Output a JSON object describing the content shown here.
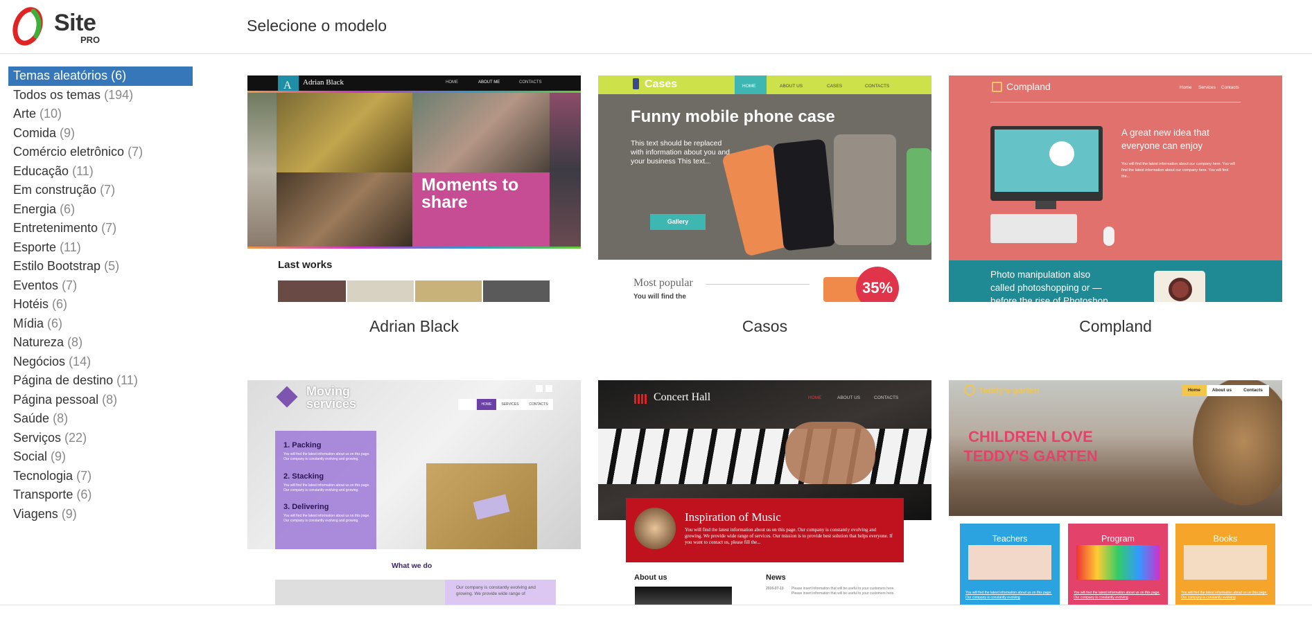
{
  "header": {
    "logo": {
      "word": "Site",
      "sub": "PRO"
    },
    "title": "Selecione o modelo"
  },
  "sidebar": {
    "categories": [
      {
        "label": "Temas aleatórios",
        "count": "(6)",
        "active": true
      },
      {
        "label": "Todos os temas",
        "count": "(194)"
      },
      {
        "label": "Arte",
        "count": "(10)"
      },
      {
        "label": "Comida",
        "count": "(9)"
      },
      {
        "label": "Comércio eletrônico",
        "count": "(7)"
      },
      {
        "label": "Educação",
        "count": "(11)"
      },
      {
        "label": "Em construção",
        "count": "(7)"
      },
      {
        "label": "Energia",
        "count": "(6)"
      },
      {
        "label": "Entretenimento",
        "count": "(7)"
      },
      {
        "label": "Esporte",
        "count": "(11)"
      },
      {
        "label": "Estilo Bootstrap",
        "count": "(5)"
      },
      {
        "label": "Eventos",
        "count": "(7)"
      },
      {
        "label": "Hotéis",
        "count": "(6)"
      },
      {
        "label": "Mídia",
        "count": "(6)"
      },
      {
        "label": "Natureza",
        "count": "(8)"
      },
      {
        "label": "Negócios",
        "count": "(14)"
      },
      {
        "label": "Página de destino",
        "count": "(11)"
      },
      {
        "label": "Página pessoal",
        "count": "(8)"
      },
      {
        "label": "Saúde",
        "count": "(8)"
      },
      {
        "label": "Serviços",
        "count": "(22)"
      },
      {
        "label": "Social",
        "count": "(9)"
      },
      {
        "label": "Tecnologia",
        "count": "(7)"
      },
      {
        "label": "Transporte",
        "count": "(6)"
      },
      {
        "label": "Viagens",
        "count": "(9)"
      }
    ]
  },
  "templates": [
    {
      "name": "Adrian Black",
      "preview": {
        "brand": "Adrian Black",
        "nav": [
          "HOME",
          "ABOUT ME",
          "CONTACTS"
        ],
        "headline": "Moments to share",
        "section": "Last works"
      }
    },
    {
      "name": "Casos",
      "preview": {
        "brand": "Cases",
        "nav": [
          "HOME",
          "ABOUT US",
          "CASES",
          "CONTACTS"
        ],
        "headline": "Funny mobile phone case",
        "body": "This text should be replaced with information about you and your business This text...",
        "button": "Gallery",
        "section": "Most popular",
        "section_sub": "You will find the",
        "badge": "35%"
      }
    },
    {
      "name": "Compland",
      "preview": {
        "brand": "Compland",
        "nav": [
          "Home",
          "Services",
          "Contacts"
        ],
        "headline": "A great new idea that everyone can enjoy",
        "body": "You will find the latest information about our company here. You will find the latest information about our company here. You will find the...",
        "footer_text": "Photo manipulation also called photoshopping or — before the rise of Photoshop software"
      }
    },
    {
      "name": "Moving services",
      "preview": {
        "brand": "Moving services",
        "nav": [
          "HOME",
          "SERVICES",
          "CONTACTS"
        ],
        "steps": [
          "1. Packing",
          "2. Stacking",
          "3. Delivering"
        ],
        "step_text": "You will find the latest information about us on this page. Our company is constantly evolving and growing.",
        "section": "What we do",
        "section_text": "Our company is constantly evolving and growing. We provide wide range of"
      }
    },
    {
      "name": "Concert Hall",
      "preview": {
        "brand": "Concert Hall",
        "nav": [
          "HOME",
          "ABOUT US",
          "CONTACTS"
        ],
        "headline": "Inspiration of Music",
        "body": "You will find the latest information about us on this page. Our company is constantly evolving and growing. We provide wide range of services. Our mission is to provide best solution that helps everyone. If you want to contact us, please fill the...",
        "about": "About us",
        "news": "News",
        "news_date": "2016-07-13",
        "news_text": "Please insert information that will be useful to your customers here. Please insert information that will be useful to your customers here."
      }
    },
    {
      "name": "Teddy's garten",
      "preview": {
        "brand": "Teddy's garten",
        "nav": [
          "Home",
          "About us",
          "Contacts"
        ],
        "headline": "CHILDREN LOVE TEDDY'S GARTEN",
        "cards": [
          "Teachers",
          "Program",
          "Books"
        ],
        "card_text": "You will find the latest information about us on this page. Our company is constantly evolving"
      }
    }
  ],
  "colors": {
    "active": "#3577b8",
    "casos_bar": "#cde24a",
    "casos_teal": "#3eb6b2",
    "compland_bg": "#e0716c",
    "compland_teal": "#1f8a94",
    "concert_red": "#c0121e",
    "teddy_pink": "#e3436b"
  }
}
